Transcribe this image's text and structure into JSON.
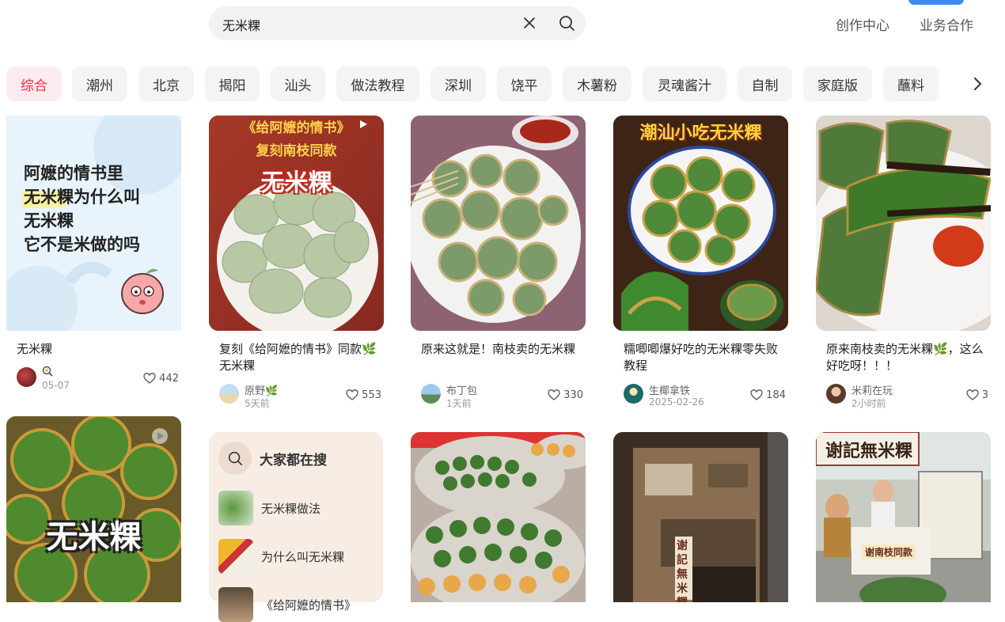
{
  "search": {
    "query": "无米粿"
  },
  "header": {
    "links": [
      "创作中心",
      "业务合作"
    ]
  },
  "chips": [
    "综合",
    "潮州",
    "北京",
    "揭阳",
    "汕头",
    "做法教程",
    "深圳",
    "饶平",
    "木薯粉",
    "灵魂酱汁",
    "自制",
    "家庭版",
    "蘸料"
  ],
  "cards": [
    {
      "title": "无米粿",
      "user": "",
      "date": "05-07",
      "likes": "442",
      "cover_text": [
        "阿嬷的情书里",
        "无米粿为什么叫",
        "无米粿",
        "它不是米做的吗"
      ]
    },
    {
      "title": "复刻《给阿嬷的情书》同款🌿无米粿",
      "user": "原野🌿",
      "date": "5天前",
      "likes": "553",
      "cover_text": [
        "《给阿嬷的情书》",
        "复刻南枝同款",
        "无米粿"
      ]
    },
    {
      "title": "原来这就是！南枝卖的无米粿",
      "user": "布丁包",
      "date": "1天前",
      "likes": "330"
    },
    {
      "title": "糯唧唧爆好吃的无米粿零失败教程",
      "user": "生椰拿铁",
      "date": "2025-02-26",
      "likes": "184",
      "cover_text": [
        "潮汕小吃无米粿"
      ]
    },
    {
      "title": "原来南枝卖的无米粿🌿，这么好吃呀！！！",
      "user": "米莉在玩",
      "date": "2小时前",
      "likes": "3"
    }
  ],
  "row2": {
    "card1_cover_text": "无米粿",
    "card5_sign": "谢記無米粿",
    "card5_sub": "谢南枝同款",
    "card4_sign": "谢記無米粿"
  },
  "hot_search": {
    "title": "大家都在搜",
    "items": [
      "无米粿做法",
      "为什么叫无米粿",
      "《给阿嬷的情书》"
    ]
  },
  "colors": {
    "accent": "#ff2442",
    "chip_active_bg": "#fdecef",
    "chip_bg": "#f4f4f4"
  }
}
